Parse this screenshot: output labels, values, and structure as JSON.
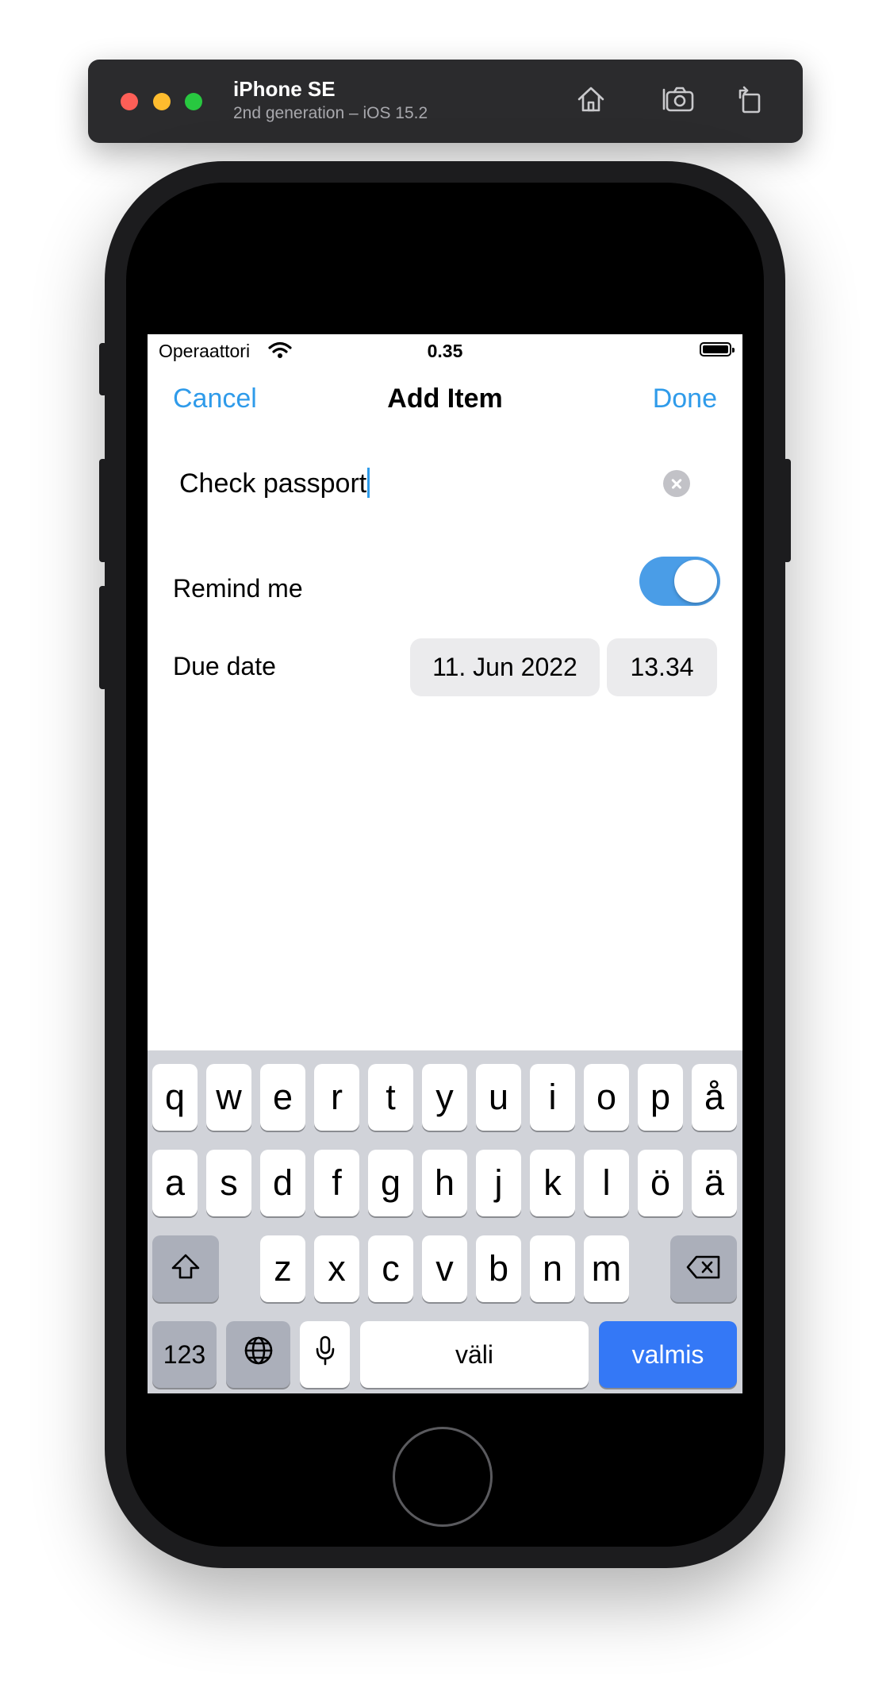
{
  "simulator": {
    "device_name": "iPhone SE",
    "device_subtitle": "2nd generation – iOS 15.2",
    "toolbar_icons": [
      "home-icon",
      "screenshot-icon",
      "rotate-icon"
    ]
  },
  "status_bar": {
    "carrier": "Operaattori",
    "time": "0.35",
    "icons": [
      "wifi-icon",
      "battery-icon"
    ]
  },
  "nav": {
    "cancel_label": "Cancel",
    "title": "Add Item",
    "done_label": "Done"
  },
  "form": {
    "item_text": "Check passport",
    "remind_label": "Remind me",
    "remind_on": true,
    "due_label": "Due date",
    "due_date": "11. Jun 2022",
    "due_time": "13.34"
  },
  "keyboard": {
    "row1": [
      "q",
      "w",
      "e",
      "r",
      "t",
      "y",
      "u",
      "i",
      "o",
      "p",
      "å"
    ],
    "row2": [
      "a",
      "s",
      "d",
      "f",
      "g",
      "h",
      "j",
      "k",
      "l",
      "ö",
      "ä"
    ],
    "row3": [
      "z",
      "x",
      "c",
      "v",
      "b",
      "n",
      "m"
    ],
    "numbers_label": "123",
    "space_label": "väli",
    "return_label": "valmis",
    "icons": [
      "shift-icon",
      "backspace-icon",
      "globe-icon",
      "microphone-icon"
    ]
  },
  "colors": {
    "accent": "#2f9bea",
    "toggle_on": "#4a9de7",
    "return_key": "#3478f6",
    "keyboard_bg": "#d1d3d9"
  }
}
